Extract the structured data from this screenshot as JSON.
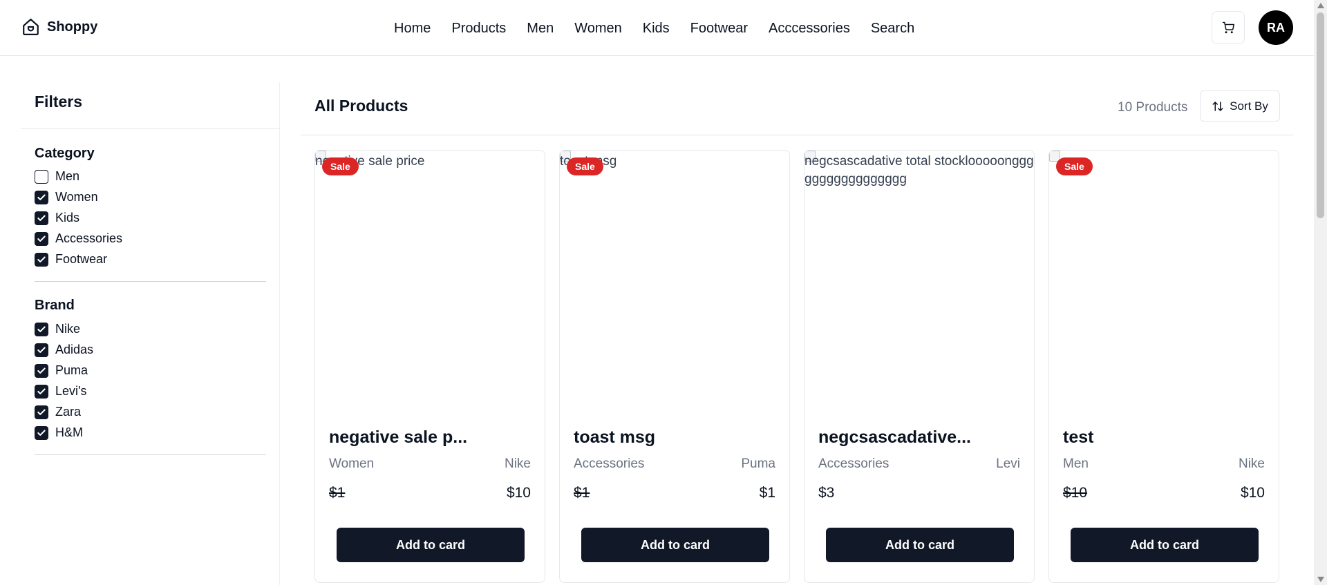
{
  "header": {
    "brand": "Shoppy",
    "nav": [
      "Home",
      "Products",
      "Men",
      "Women",
      "Kids",
      "Footwear",
      "Acccessories",
      "Search"
    ],
    "avatar_initials": "RA",
    "cart_icon": "cart-icon"
  },
  "filters": {
    "title": "Filters",
    "category": {
      "title": "Category",
      "options": [
        {
          "label": "Men",
          "checked": false
        },
        {
          "label": "Women",
          "checked": true
        },
        {
          "label": "Kids",
          "checked": true
        },
        {
          "label": "Accessories",
          "checked": true
        },
        {
          "label": "Footwear",
          "checked": true
        }
      ]
    },
    "brand": {
      "title": "Brand",
      "options": [
        {
          "label": "Nike",
          "checked": true
        },
        {
          "label": "Adidas",
          "checked": true
        },
        {
          "label": "Puma",
          "checked": true
        },
        {
          "label": "Levi's",
          "checked": true
        },
        {
          "label": "Zara",
          "checked": true
        },
        {
          "label": "H&M",
          "checked": true
        }
      ]
    }
  },
  "main": {
    "title": "All Products",
    "count": "10 Products",
    "sort_label": "Sort By"
  },
  "products": [
    {
      "img_alt": "negative sale price",
      "sale_badge": "Sale",
      "name": "negative sale p...",
      "category": "Women",
      "brand": "Nike",
      "old_price": "$1",
      "price": "$10",
      "button": "Add to card"
    },
    {
      "img_alt": "toast msg",
      "sale_badge": "Sale",
      "name": "toast msg",
      "category": "Accessories",
      "brand": "Puma",
      "old_price": "$1",
      "price": "$1",
      "button": "Add to card"
    },
    {
      "img_alt": "negcsascadative total stocklooooonggggggggggggggggg",
      "sale_badge": "",
      "name": "negcsascadative...",
      "category": "Accessories",
      "brand": "Levi",
      "old_price": "",
      "price": "$3",
      "button": "Add to card"
    },
    {
      "img_alt": "",
      "sale_badge": "Sale",
      "name": "test",
      "category": "Men",
      "brand": "Nike",
      "old_price": "$10",
      "price": "$10",
      "button": "Add to card"
    }
  ],
  "colors": {
    "primary": "#111827",
    "sale": "#dc2626",
    "muted": "#6b7280",
    "border": "#e5e7eb"
  }
}
